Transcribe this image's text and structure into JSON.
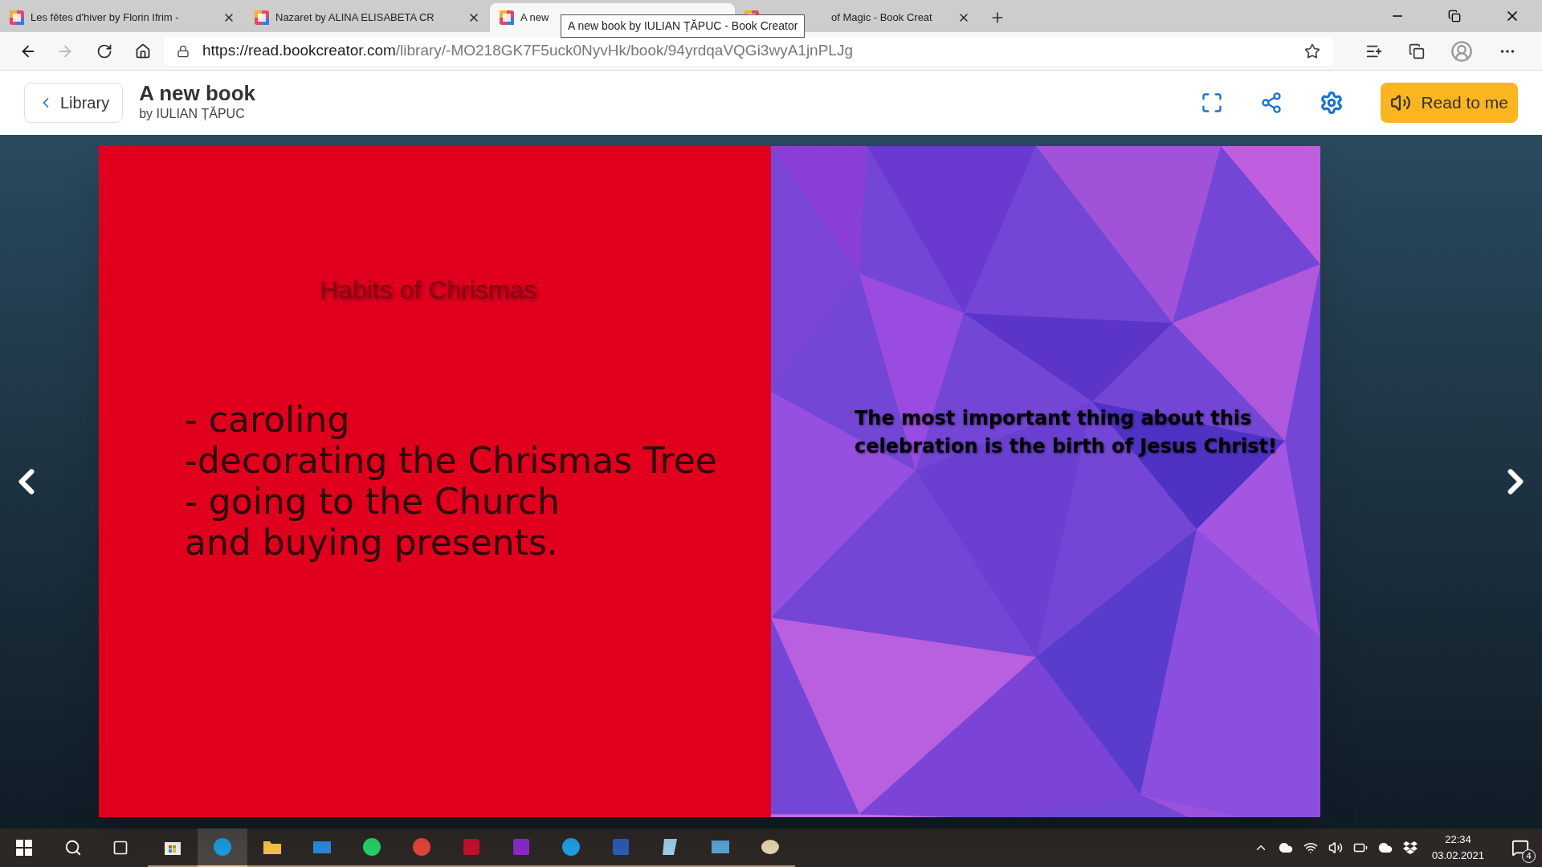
{
  "browser": {
    "tabs": [
      {
        "title": "Les fêtes d'hiver by Florin Ifrim -",
        "selected": false
      },
      {
        "title": "Nazaret by ALINA ELISABETA CR",
        "selected": false
      },
      {
        "title": "A new",
        "selected": true
      },
      {
        "title": "of Magic - Book Creat",
        "selected": false
      }
    ],
    "tooltip": "A new book by IULIAN ȚĂPUC - Book Creator",
    "url_host": "https://read.bookcreator.com",
    "url_path": "/library/-MO218GK7F5uck0NyvHk/book/94yrdqaVQGi3wyA1jnPLJg"
  },
  "header": {
    "back_label": "Library",
    "title": "A new book",
    "author": "by IULIAN ȚĂPUC",
    "read_button": "Read to me"
  },
  "book": {
    "left_page": {
      "heading": "Habits of Chrismas",
      "lines": [
        "- caroling",
        "-decorating the Chrismas Tree",
        "- going to the Church",
        "and buying presents."
      ]
    },
    "right_page": {
      "text": "The most important thing about this celebration is the birth of Jesus Christ!"
    }
  },
  "taskbar": {
    "apps": [
      {
        "kind": "store",
        "color": "#f3f3f3",
        "active": false
      },
      {
        "kind": "edge",
        "color": "#1b9de2",
        "active": true
      },
      {
        "kind": "folder",
        "color": "#f8c648",
        "active": false
      },
      {
        "kind": "mail",
        "color": "#2a8ae0",
        "active": false
      },
      {
        "kind": "chat",
        "color": "#25d366",
        "active": false
      },
      {
        "kind": "browser",
        "color": "#e8453c",
        "active": false
      },
      {
        "kind": "reader",
        "color": "#c8102e",
        "active": false
      },
      {
        "kind": "notes",
        "color": "#8a2bd0",
        "active": false
      },
      {
        "kind": "globe",
        "color": "#1ea0e6",
        "active": false
      },
      {
        "kind": "doc",
        "color": "#2b5eb8",
        "active": false
      },
      {
        "kind": "notepad",
        "color": "#9fd2e8",
        "active": false
      },
      {
        "kind": "photo",
        "color": "#5aa6d8",
        "active": false
      },
      {
        "kind": "paint",
        "color": "#e8d8b0",
        "active": false
      }
    ],
    "time": "22:34",
    "date": "03.02.2021",
    "notifications": "4"
  }
}
